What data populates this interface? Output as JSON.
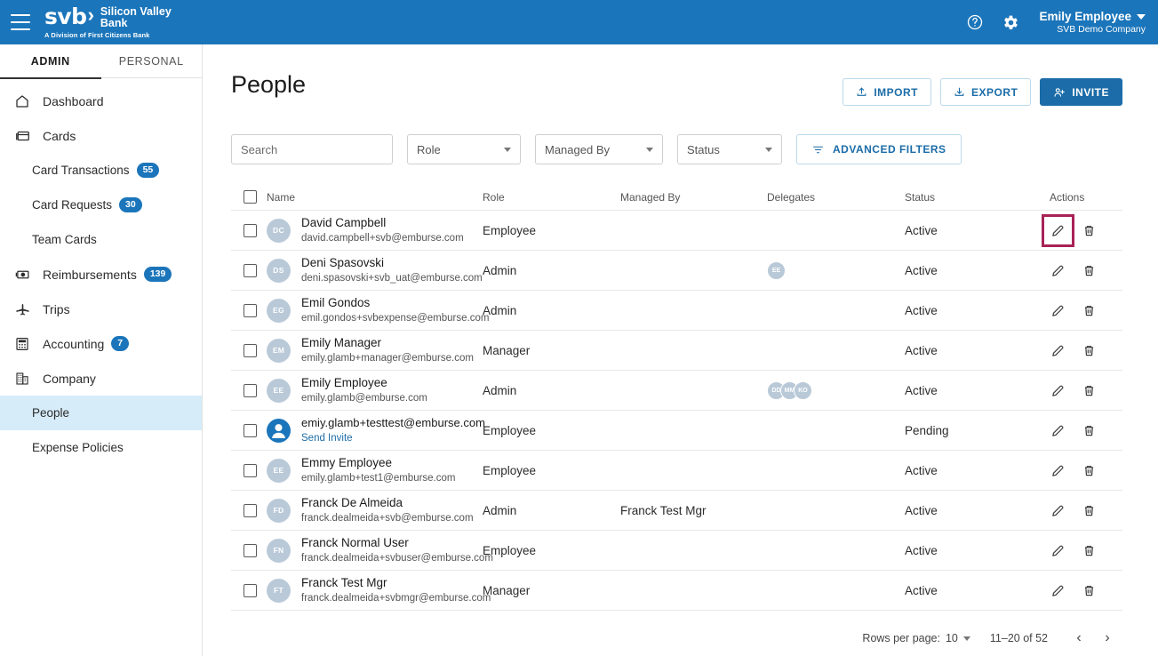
{
  "topbar": {
    "logo": {
      "mark": "svb",
      "chevron": "›",
      "name_line1": "Silicon Valley",
      "name_line2": "Bank",
      "tagline": "A Division of First Citizens Bank"
    },
    "help_icon": "help-circle-icon",
    "settings_icon": "gear-icon",
    "user": {
      "name": "Emily Employee",
      "company": "SVB Demo Company"
    },
    "brand_color": "#1b75ba"
  },
  "sidebar": {
    "tabs": [
      {
        "label": "ADMIN",
        "active": true
      },
      {
        "label": "PERSONAL",
        "active": false
      }
    ],
    "items": [
      {
        "label": "Dashboard",
        "icon": "home-icon",
        "badge": "",
        "sub": false,
        "active": false
      },
      {
        "label": "Cards",
        "icon": "credit-card-icon",
        "badge": "",
        "sub": false,
        "active": false
      },
      {
        "label": "Card Transactions",
        "icon": "",
        "badge": "55",
        "sub": true,
        "active": false
      },
      {
        "label": "Card Requests",
        "icon": "",
        "badge": "30",
        "sub": true,
        "active": false
      },
      {
        "label": "Team Cards",
        "icon": "",
        "badge": "",
        "sub": true,
        "active": false
      },
      {
        "label": "Reimbursements",
        "icon": "banknote-icon",
        "badge": "139",
        "sub": false,
        "active": false
      },
      {
        "label": "Trips",
        "icon": "airplane-icon",
        "badge": "",
        "sub": false,
        "active": false
      },
      {
        "label": "Accounting",
        "icon": "calculator-icon",
        "badge": "7",
        "sub": false,
        "active": false
      },
      {
        "label": "Company",
        "icon": "building-icon",
        "badge": "",
        "sub": false,
        "active": false
      },
      {
        "label": "People",
        "icon": "",
        "badge": "",
        "sub": true,
        "active": true
      },
      {
        "label": "Expense Policies",
        "icon": "",
        "badge": "",
        "sub": true,
        "active": false
      }
    ],
    "active_bg": "#d6ecf9"
  },
  "main": {
    "title": "People",
    "buttons": {
      "import": "IMPORT",
      "export": "EXPORT",
      "invite": "INVITE"
    },
    "filters": {
      "search_placeholder": "Search",
      "search_value": "",
      "role": "Role",
      "managed_by": "Managed By",
      "status": "Status",
      "advanced": "ADVANCED FILTERS"
    },
    "table": {
      "columns": [
        "Name",
        "Role",
        "Managed By",
        "Delegates",
        "Status",
        "Actions"
      ],
      "rows": [
        {
          "initials": "DC",
          "name": "David Campbell",
          "email": "david.campbell+svb@emburse.com",
          "role": "Employee",
          "managed_by": "",
          "delegates": [],
          "status": "Active",
          "pending": false,
          "edit_highlight": true
        },
        {
          "initials": "DS",
          "name": "Deni Spasovski",
          "email": "deni.spasovski+svb_uat@emburse.com",
          "role": "Admin",
          "managed_by": "",
          "delegates": [
            "EE"
          ],
          "status": "Active",
          "pending": false,
          "edit_highlight": false
        },
        {
          "initials": "EG",
          "name": "Emil Gondos",
          "email": "emil.gondos+svbexpense@emburse.com",
          "role": "Admin",
          "managed_by": "",
          "delegates": [],
          "status": "Active",
          "pending": false,
          "edit_highlight": false
        },
        {
          "initials": "EM",
          "name": "Emily Manager",
          "email": "emily.glamb+manager@emburse.com",
          "role": "Manager",
          "managed_by": "",
          "delegates": [],
          "status": "Active",
          "pending": false,
          "edit_highlight": false
        },
        {
          "initials": "EE",
          "name": "Emily Employee",
          "email": "emily.glamb@emburse.com",
          "role": "Admin",
          "managed_by": "",
          "delegates": [
            "DD",
            "MM",
            "KO"
          ],
          "status": "Active",
          "pending": false,
          "edit_highlight": false
        },
        {
          "initials": "",
          "name": "emiy.glamb+testtest@emburse.com",
          "email": "Send Invite",
          "role": "Employee",
          "managed_by": "",
          "delegates": [],
          "status": "Pending",
          "pending": true,
          "edit_highlight": false
        },
        {
          "initials": "EE",
          "name": "Emmy Employee",
          "email": "emily.glamb+test1@emburse.com",
          "role": "Employee",
          "managed_by": "",
          "delegates": [],
          "status": "Active",
          "pending": false,
          "edit_highlight": false
        },
        {
          "initials": "FD",
          "name": "Franck De Almeida",
          "email": "franck.dealmeida+svb@emburse.com",
          "role": "Admin",
          "managed_by": "Franck Test Mgr",
          "delegates": [],
          "status": "Active",
          "pending": false,
          "edit_highlight": false
        },
        {
          "initials": "FN",
          "name": "Franck Normal User",
          "email": "franck.dealmeida+svbuser@emburse.com",
          "role": "Employee",
          "managed_by": "",
          "delegates": [],
          "status": "Active",
          "pending": false,
          "edit_highlight": false
        },
        {
          "initials": "FT",
          "name": "Franck Test Mgr",
          "email": "franck.dealmeida+svbmgr@emburse.com",
          "role": "Manager",
          "managed_by": "",
          "delegates": [],
          "status": "Active",
          "pending": false,
          "edit_highlight": false
        }
      ]
    },
    "pagination": {
      "rows_per_page_label": "Rows per page:",
      "rows_per_page_value": "10",
      "range": "11–20 of 52",
      "prev_icon": "chevron-left-icon",
      "next_icon": "chevron-right-icon"
    },
    "highlight_color": "#a82257"
  }
}
